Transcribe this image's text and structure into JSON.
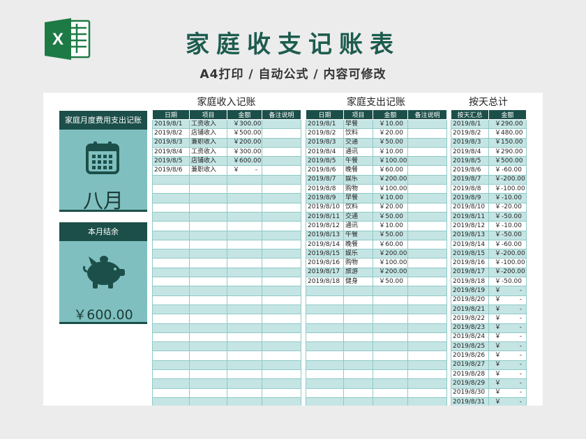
{
  "header": {
    "title": "家庭收支记账表",
    "subtitle": "A4打印 / 自动公式 / 内容可修改"
  },
  "colors": {
    "dark": "#1c4f49",
    "teal": "#7fbfbf",
    "stripe": "#c4e5e4",
    "brand": "#1d5c4e"
  },
  "sidebar": {
    "monthly_card": {
      "title": "家庭月度费用支出记账",
      "icon": "calendar-icon",
      "month": "八月"
    },
    "balance_card": {
      "title": "本月结余",
      "icon": "piggy-bank-icon",
      "amount": "￥600.00"
    }
  },
  "income": {
    "title": "家庭收入记账",
    "columns": [
      "日期",
      "项目",
      "金额",
      "备注说明"
    ],
    "rows": [
      {
        "date": "2019/8/1",
        "item": "工资收入",
        "amount": "300.00"
      },
      {
        "date": "2019/8/2",
        "item": "店铺收入",
        "amount": "500.00"
      },
      {
        "date": "2019/8/3",
        "item": "兼职收入",
        "amount": "200.00"
      },
      {
        "date": "2019/8/4",
        "item": "工资收入",
        "amount": "300.00"
      },
      {
        "date": "2019/8/5",
        "item": "店铺收入",
        "amount": "600.00"
      },
      {
        "date": "2019/8/6",
        "item": "兼职收入",
        "amount": "-"
      }
    ]
  },
  "expense": {
    "title": "家庭支出记账",
    "columns": [
      "日期",
      "项目",
      "金额",
      "备注说明"
    ],
    "rows": [
      {
        "date": "2019/8/1",
        "item": "早餐",
        "amount": "10.00"
      },
      {
        "date": "2019/8/2",
        "item": "饮料",
        "amount": "20.00"
      },
      {
        "date": "2019/8/3",
        "item": "交通",
        "amount": "50.00"
      },
      {
        "date": "2019/8/4",
        "item": "通讯",
        "amount": "10.00"
      },
      {
        "date": "2019/8/5",
        "item": "午餐",
        "amount": "100.00"
      },
      {
        "date": "2019/8/6",
        "item": "晚餐",
        "amount": "60.00"
      },
      {
        "date": "2019/8/7",
        "item": "娱乐",
        "amount": "200.00"
      },
      {
        "date": "2019/8/8",
        "item": "购物",
        "amount": "100.00"
      },
      {
        "date": "2019/8/9",
        "item": "早餐",
        "amount": "10.00"
      },
      {
        "date": "2019/8/10",
        "item": "饮料",
        "amount": "20.00"
      },
      {
        "date": "2019/8/11",
        "item": "交通",
        "amount": "50.00"
      },
      {
        "date": "2019/8/12",
        "item": "通讯",
        "amount": "10.00"
      },
      {
        "date": "2019/8/13",
        "item": "午餐",
        "amount": "50.00"
      },
      {
        "date": "2019/8/14",
        "item": "晚餐",
        "amount": "60.00"
      },
      {
        "date": "2019/8/15",
        "item": "娱乐",
        "amount": "200.00"
      },
      {
        "date": "2019/8/16",
        "item": "购物",
        "amount": "100.00"
      },
      {
        "date": "2019/8/17",
        "item": "旅游",
        "amount": "200.00"
      },
      {
        "date": "2019/8/18",
        "item": "健身",
        "amount": "50.00"
      }
    ]
  },
  "daily": {
    "title": "按天总计",
    "columns": [
      "按天汇总",
      "金额"
    ],
    "rows": [
      {
        "date": "2019/8/1",
        "amount": "290.00"
      },
      {
        "date": "2019/8/2",
        "amount": "480.00"
      },
      {
        "date": "2019/8/3",
        "amount": "150.00"
      },
      {
        "date": "2019/8/4",
        "amount": "290.00"
      },
      {
        "date": "2019/8/5",
        "amount": "500.00"
      },
      {
        "date": "2019/8/6",
        "amount": "-60.00"
      },
      {
        "date": "2019/8/7",
        "amount": "-200.00"
      },
      {
        "date": "2019/8/8",
        "amount": "-100.00"
      },
      {
        "date": "2019/8/9",
        "amount": "-10.00"
      },
      {
        "date": "2019/8/10",
        "amount": "-20.00"
      },
      {
        "date": "2019/8/11",
        "amount": "-50.00"
      },
      {
        "date": "2019/8/12",
        "amount": "-10.00"
      },
      {
        "date": "2019/8/13",
        "amount": "-50.00"
      },
      {
        "date": "2019/8/14",
        "amount": "-60.00"
      },
      {
        "date": "2019/8/15",
        "amount": "-200.00"
      },
      {
        "date": "2019/8/16",
        "amount": "-100.00"
      },
      {
        "date": "2019/8/17",
        "amount": "-200.00"
      },
      {
        "date": "2019/8/18",
        "amount": "-50.00"
      },
      {
        "date": "2019/8/19",
        "amount": "-"
      },
      {
        "date": "2019/8/20",
        "amount": "-"
      },
      {
        "date": "2019/8/21",
        "amount": "-"
      },
      {
        "date": "2019/8/22",
        "amount": "-"
      },
      {
        "date": "2019/8/23",
        "amount": "-"
      },
      {
        "date": "2019/8/24",
        "amount": "-"
      },
      {
        "date": "2019/8/25",
        "amount": "-"
      },
      {
        "date": "2019/8/26",
        "amount": "-"
      },
      {
        "date": "2019/8/27",
        "amount": "-"
      },
      {
        "date": "2019/8/28",
        "amount": "-"
      },
      {
        "date": "2019/8/29",
        "amount": "-"
      },
      {
        "date": "2019/8/30",
        "amount": "-"
      },
      {
        "date": "2019/8/31",
        "amount": "-"
      }
    ]
  },
  "currency_symbol": "￥"
}
